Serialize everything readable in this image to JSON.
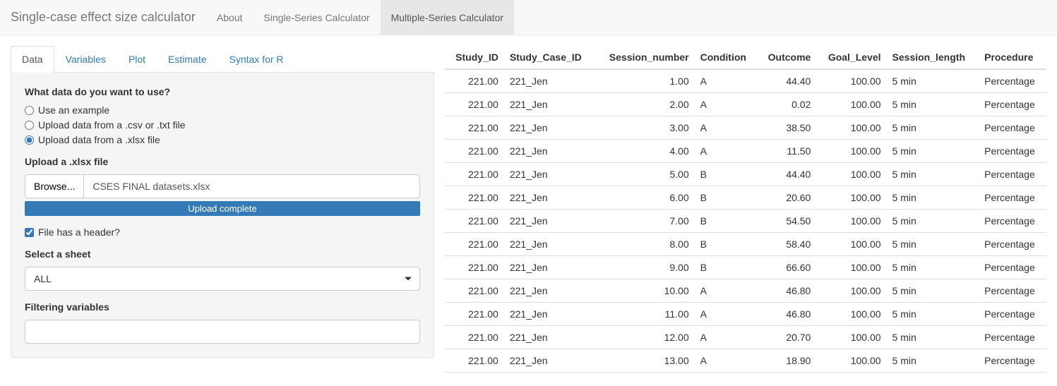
{
  "navbar": {
    "brand": "Single-case effect size calculator",
    "items": [
      {
        "label": "About"
      },
      {
        "label": "Single-Series Calculator"
      },
      {
        "label": "Multiple-Series Calculator",
        "active": true
      }
    ]
  },
  "tabs": [
    {
      "label": "Data",
      "active": true
    },
    {
      "label": "Variables"
    },
    {
      "label": "Plot"
    },
    {
      "label": "Estimate"
    },
    {
      "label": "Syntax for R"
    }
  ],
  "form": {
    "data_question": "What data do you want to use?",
    "radio_options": [
      {
        "label": "Use an example",
        "value": "example",
        "checked": false
      },
      {
        "label": "Upload data from a .csv or .txt file",
        "value": "csv",
        "checked": false
      },
      {
        "label": "Upload data from a .xlsx file",
        "value": "xlsx",
        "checked": true
      }
    ],
    "upload_label": "Upload a .xlsx file",
    "browse_label": "Browse...",
    "file_name": "CSES FINAL datasets.xlsx",
    "progress_text": "Upload complete",
    "header_checkbox_label": "File has a header?",
    "header_checked": true,
    "sheet_label": "Select a sheet",
    "sheet_value": "ALL",
    "filter_label": "Filtering variables",
    "filter_value": ""
  },
  "table": {
    "columns": [
      {
        "key": "Study_ID",
        "label": "Study_ID",
        "align": "num"
      },
      {
        "key": "Study_Case_ID",
        "label": "Study_Case_ID",
        "align": "text"
      },
      {
        "key": "Session_number",
        "label": "Session_number",
        "align": "num"
      },
      {
        "key": "Condition",
        "label": "Condition",
        "align": "text"
      },
      {
        "key": "Outcome",
        "label": "Outcome",
        "align": "num"
      },
      {
        "key": "Goal_Level",
        "label": "Goal_Level",
        "align": "num"
      },
      {
        "key": "Session_length",
        "label": "Session_length",
        "align": "text"
      },
      {
        "key": "Procedure",
        "label": "Procedure",
        "align": "text"
      }
    ],
    "rows": [
      {
        "Study_ID": "221.00",
        "Study_Case_ID": "221_Jen",
        "Session_number": "1.00",
        "Condition": "A",
        "Outcome": "44.40",
        "Goal_Level": "100.00",
        "Session_length": "5 min",
        "Procedure": "Percentage"
      },
      {
        "Study_ID": "221.00",
        "Study_Case_ID": "221_Jen",
        "Session_number": "2.00",
        "Condition": "A",
        "Outcome": "0.02",
        "Goal_Level": "100.00",
        "Session_length": "5 min",
        "Procedure": "Percentage"
      },
      {
        "Study_ID": "221.00",
        "Study_Case_ID": "221_Jen",
        "Session_number": "3.00",
        "Condition": "A",
        "Outcome": "38.50",
        "Goal_Level": "100.00",
        "Session_length": "5 min",
        "Procedure": "Percentage"
      },
      {
        "Study_ID": "221.00",
        "Study_Case_ID": "221_Jen",
        "Session_number": "4.00",
        "Condition": "A",
        "Outcome": "11.50",
        "Goal_Level": "100.00",
        "Session_length": "5 min",
        "Procedure": "Percentage"
      },
      {
        "Study_ID": "221.00",
        "Study_Case_ID": "221_Jen",
        "Session_number": "5.00",
        "Condition": "B",
        "Outcome": "44.40",
        "Goal_Level": "100.00",
        "Session_length": "5 min",
        "Procedure": "Percentage"
      },
      {
        "Study_ID": "221.00",
        "Study_Case_ID": "221_Jen",
        "Session_number": "6.00",
        "Condition": "B",
        "Outcome": "20.60",
        "Goal_Level": "100.00",
        "Session_length": "5 min",
        "Procedure": "Percentage"
      },
      {
        "Study_ID": "221.00",
        "Study_Case_ID": "221_Jen",
        "Session_number": "7.00",
        "Condition": "B",
        "Outcome": "54.50",
        "Goal_Level": "100.00",
        "Session_length": "5 min",
        "Procedure": "Percentage"
      },
      {
        "Study_ID": "221.00",
        "Study_Case_ID": "221_Jen",
        "Session_number": "8.00",
        "Condition": "B",
        "Outcome": "58.40",
        "Goal_Level": "100.00",
        "Session_length": "5 min",
        "Procedure": "Percentage"
      },
      {
        "Study_ID": "221.00",
        "Study_Case_ID": "221_Jen",
        "Session_number": "9.00",
        "Condition": "B",
        "Outcome": "66.60",
        "Goal_Level": "100.00",
        "Session_length": "5 min",
        "Procedure": "Percentage"
      },
      {
        "Study_ID": "221.00",
        "Study_Case_ID": "221_Jen",
        "Session_number": "10.00",
        "Condition": "A",
        "Outcome": "46.80",
        "Goal_Level": "100.00",
        "Session_length": "5 min",
        "Procedure": "Percentage"
      },
      {
        "Study_ID": "221.00",
        "Study_Case_ID": "221_Jen",
        "Session_number": "11.00",
        "Condition": "A",
        "Outcome": "46.80",
        "Goal_Level": "100.00",
        "Session_length": "5 min",
        "Procedure": "Percentage"
      },
      {
        "Study_ID": "221.00",
        "Study_Case_ID": "221_Jen",
        "Session_number": "12.00",
        "Condition": "A",
        "Outcome": "20.70",
        "Goal_Level": "100.00",
        "Session_length": "5 min",
        "Procedure": "Percentage"
      },
      {
        "Study_ID": "221.00",
        "Study_Case_ID": "221_Jen",
        "Session_number": "13.00",
        "Condition": "A",
        "Outcome": "18.90",
        "Goal_Level": "100.00",
        "Session_length": "5 min",
        "Procedure": "Percentage"
      }
    ]
  }
}
